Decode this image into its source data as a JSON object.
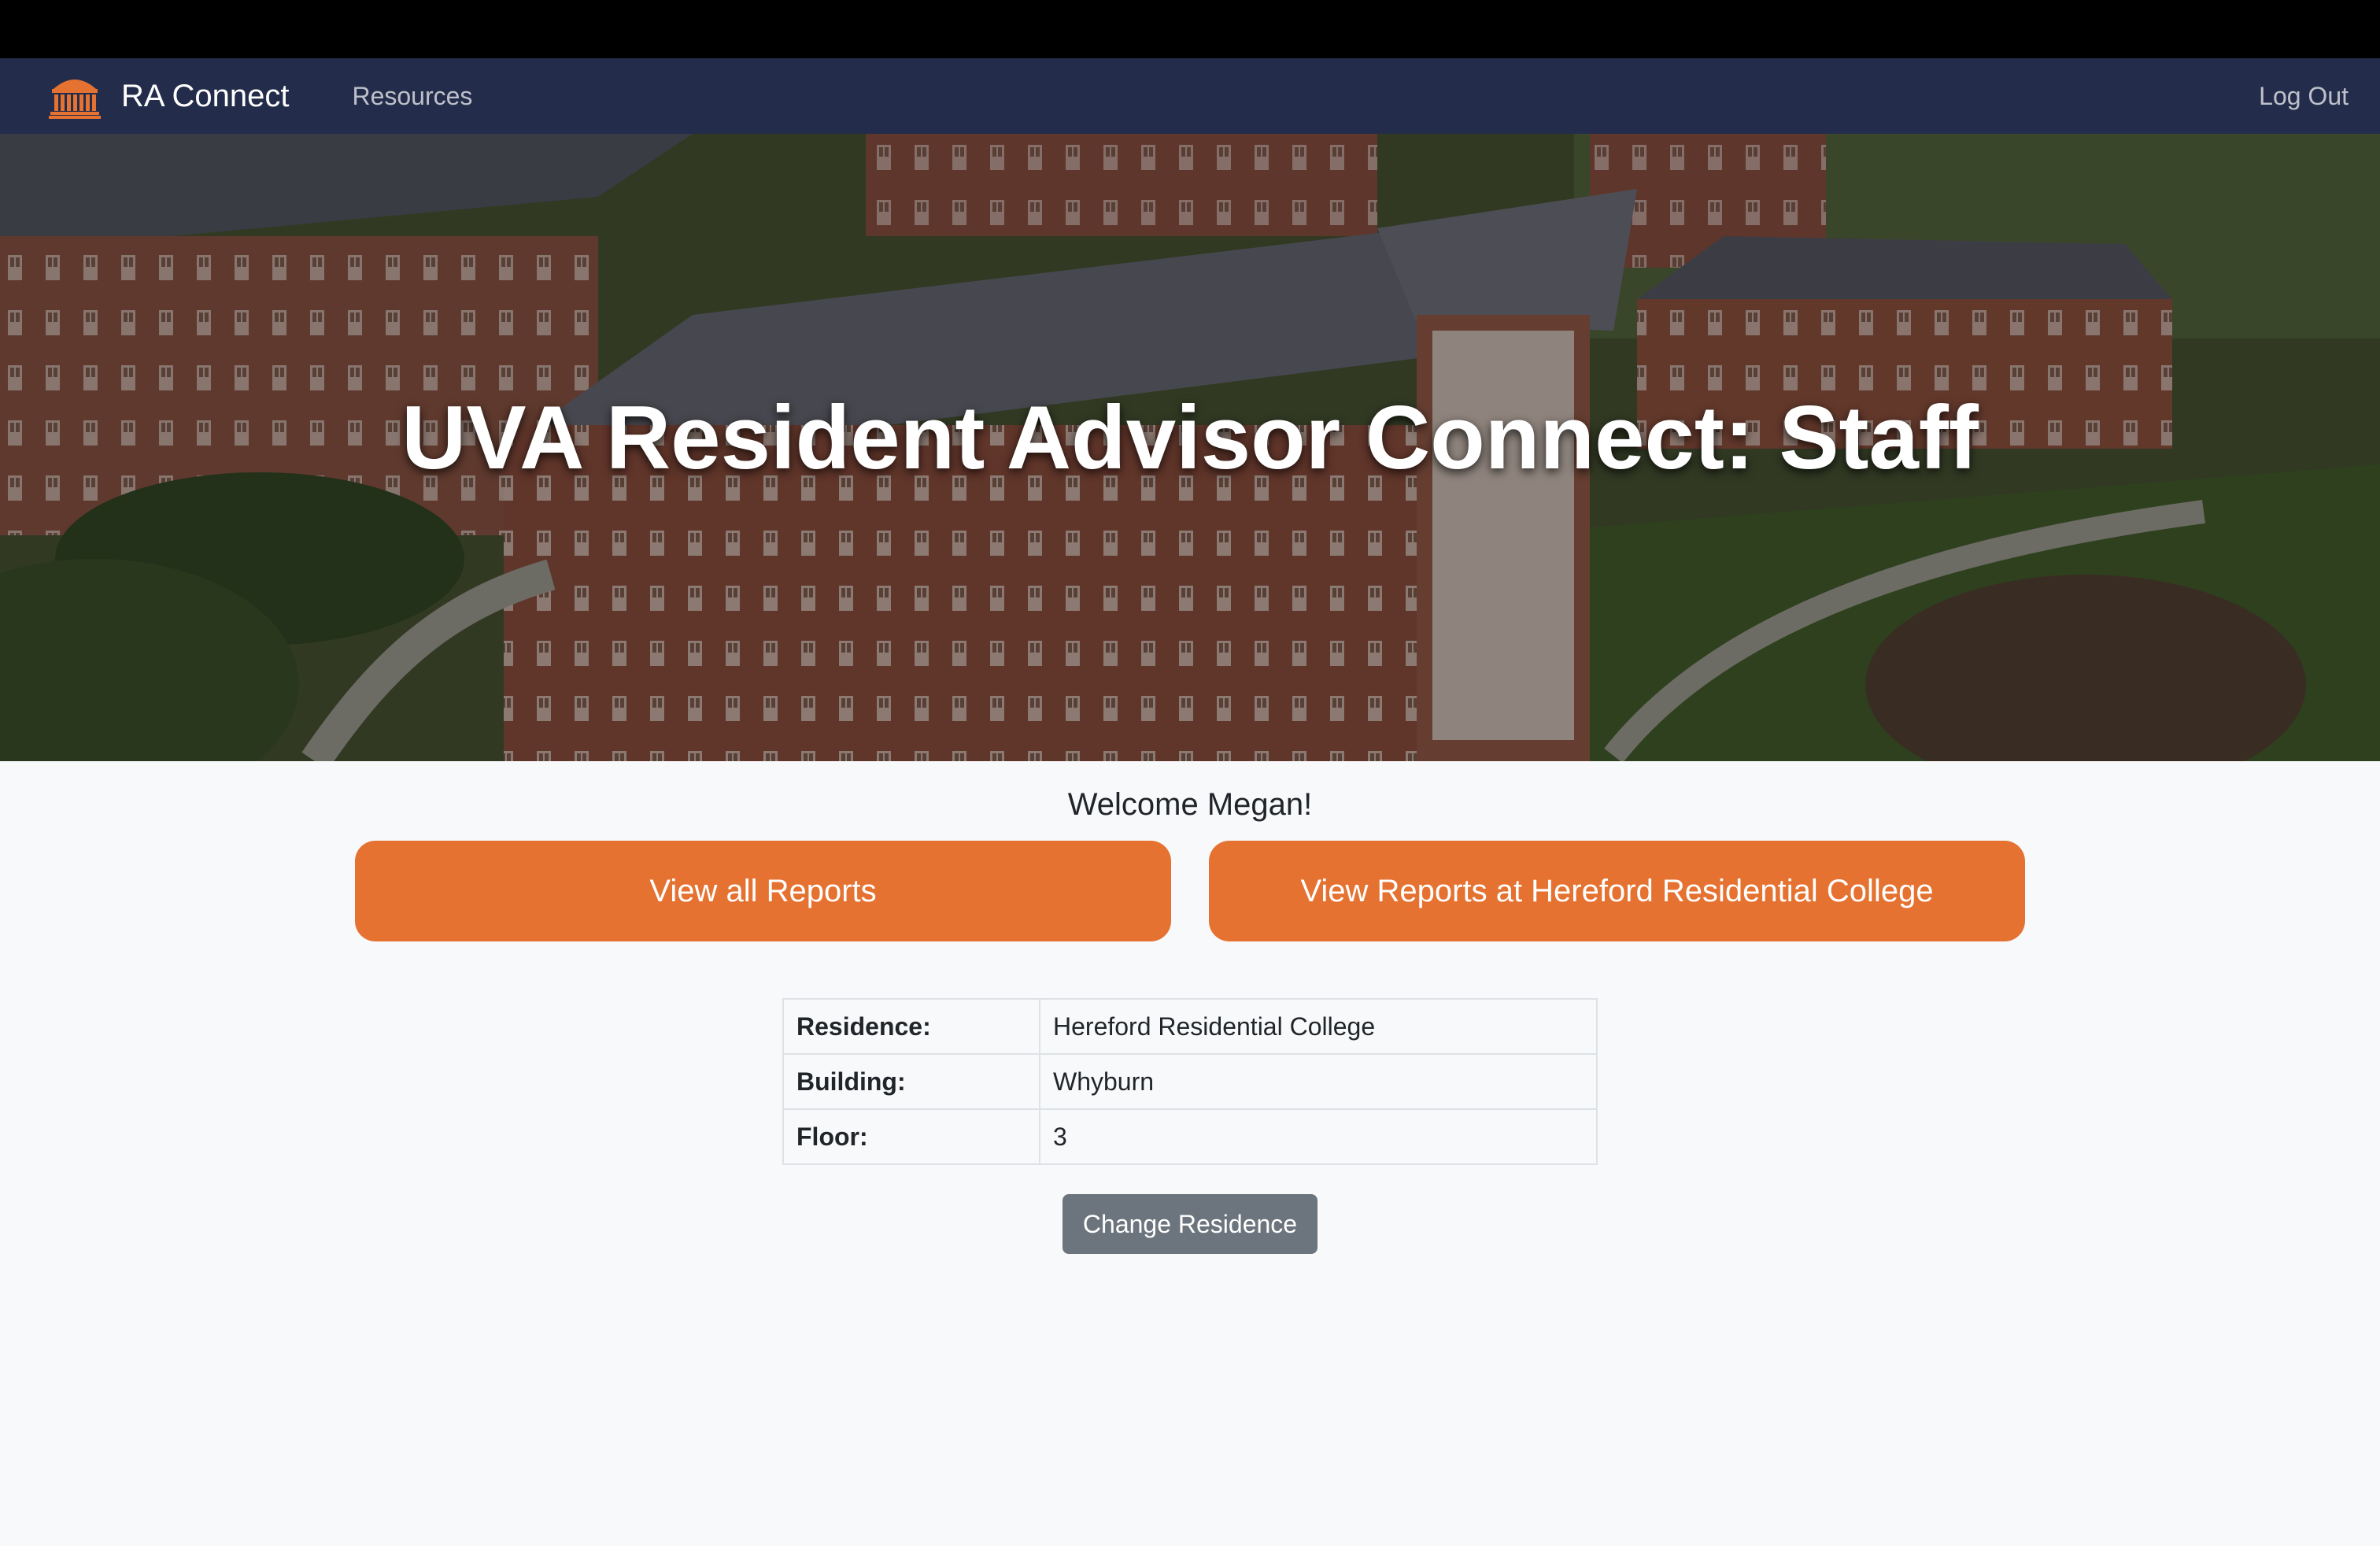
{
  "navbar": {
    "brand": "RA Connect",
    "brand_icon": "rotunda-icon",
    "links": [
      "Resources"
    ],
    "logout": "Log Out",
    "background": "#232d4b"
  },
  "hero": {
    "title": "UVA Resident Advisor Connect: Staff",
    "image": "aerial photo of brick residence hall buildings"
  },
  "welcome": "Welcome Megan!",
  "buttons": {
    "view_all": "View all Reports",
    "view_residence": "View Reports at Hereford Residential College",
    "accent": "#e57231"
  },
  "residence_table": {
    "rows": [
      {
        "label": "Residence:",
        "value": "Hereford Residential College"
      },
      {
        "label": "Building:",
        "value": "Whyburn"
      },
      {
        "label": "Floor:",
        "value": "3"
      }
    ]
  },
  "change_button": "Change Residence"
}
